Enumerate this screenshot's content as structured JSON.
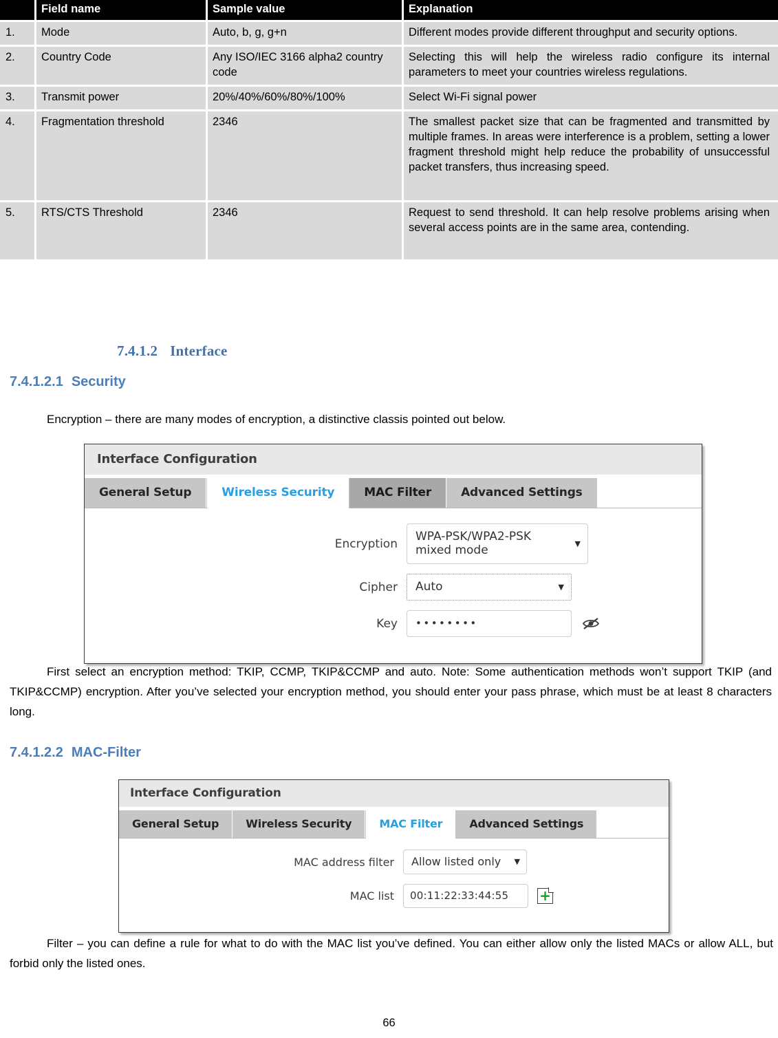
{
  "table": {
    "headers": [
      "",
      "Field name",
      "Sample value",
      "Explanation"
    ],
    "rows": [
      {
        "num": "1.",
        "field": "Mode",
        "sample": "Auto, b, g, g+n",
        "explanation": "Different modes provide different throughput and security options."
      },
      {
        "num": "2.",
        "field": "Country Code",
        "sample": "Any ISO/IEC 3166 alpha2 country code",
        "explanation": "Selecting this will help the wireless radio configure its internal parameters to meet your countries wireless regulations."
      },
      {
        "num": "3.",
        "field": "Transmit power",
        "sample": "20%/40%/60%/80%/100%",
        "explanation": "Select Wi-Fi signal power"
      },
      {
        "num": "4.",
        "field": "Fragmentation threshold",
        "sample": "2346",
        "explanation": "The smallest packet size that can be fragmented and transmitted by multiple frames. In areas were interference is a problem, setting a lower fragment threshold might help reduce the probability of unsuccessful packet transfers, thus increasing speed."
      },
      {
        "num": "5.",
        "field": "RTS/CTS Threshold",
        "sample": "2346",
        "explanation": "Request to send threshold. It can help resolve problems arising when several access points are in the same area, contending."
      }
    ]
  },
  "headings": {
    "interface_num": "7.4.1.2",
    "interface_title": "Interface",
    "security_num": "7.4.1.2.1",
    "security_title": "Security",
    "macfilter_num": "7.4.1.2.2",
    "macfilter_title": "MAC-Filter"
  },
  "paragraphs": {
    "encryption": "Encryption – there are many modes of encryption, a distinctive classis pointed out below.",
    "tkip": "First select an encryption method: TKIP, CCMP, TKIP&CCMP and auto. Note: Some authentication methods won’t support TKIP (and TKIP&CCMP) encryption.  After you’ve selected your encryption method, you should enter your pass phrase, which must be at least 8 characters long.",
    "filter": "Filter – you can define a rule for what to do with the MAC list you’ve defined. You can either allow only the listed MACs or allow ALL, but forbid only the listed ones."
  },
  "security_shot": {
    "title": "Interface Configuration",
    "tabs": [
      {
        "label": "General Setup",
        "state": "normal"
      },
      {
        "label": "Wireless Security",
        "state": "active"
      },
      {
        "label": "MAC Filter",
        "state": "hover"
      },
      {
        "label": "Advanced Settings",
        "state": "normal"
      }
    ],
    "fields": {
      "encryption_label": "Encryption",
      "encryption_value": "WPA-PSK/WPA2-PSK mixed mode",
      "cipher_label": "Cipher",
      "cipher_value": "Auto",
      "key_label": "Key",
      "key_value": "••••••••",
      "reveal_icon": "eye-slash-icon"
    }
  },
  "macfilter_shot": {
    "title": "Interface Configuration",
    "tabs": [
      {
        "label": "General Setup",
        "state": "normal"
      },
      {
        "label": "Wireless Security",
        "state": "normal"
      },
      {
        "label": "MAC Filter",
        "state": "active"
      },
      {
        "label": "Advanced Settings",
        "state": "normal"
      }
    ],
    "fields": {
      "mac_address_filter_label": "MAC address filter",
      "mac_address_filter_value": "Allow listed only",
      "mac_list_label": "MAC list",
      "mac_list_value": "00:11:22:33:44:55",
      "add_icon": "add-page-icon"
    }
  },
  "footer": {
    "page_number": "66"
  },
  "colors": {
    "heading_blue": "#4a7ebb",
    "tab_active_blue": "#2a9fe0",
    "table_header_bg": "#000000",
    "table_cell_bg": "#d9d9d9",
    "add_plus_green": "#18a018"
  }
}
